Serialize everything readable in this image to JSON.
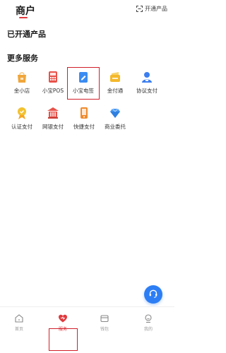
{
  "header": {
    "title": "商户",
    "open_product_label": "开通产品",
    "accent": "#e03a3e"
  },
  "sections": {
    "opened_title": "已开通产品",
    "more_title": "更多服务"
  },
  "services": [
    {
      "label": "金小店",
      "icon": "shop-icon",
      "color": "#f0a63a"
    },
    {
      "label": "小宝POS",
      "icon": "pos-terminal-icon",
      "color": "#e8524a"
    },
    {
      "label": "小宝电签",
      "icon": "e-sign-icon",
      "color": "#3b8cf2",
      "highlighted": true
    },
    {
      "label": "金付通",
      "icon": "wallet-card-icon",
      "color": "#f4b82a"
    },
    {
      "label": "协议支付",
      "icon": "user-agreement-icon",
      "color": "#3b7ef0"
    },
    {
      "label": "认证支付",
      "icon": "verified-badge-icon",
      "color": "#f2c230"
    },
    {
      "label": "网银支付",
      "icon": "bank-icon",
      "color": "#e8524a"
    },
    {
      "label": "快捷支付",
      "icon": "quick-pay-phone-icon",
      "color": "#f08a2c"
    },
    {
      "label": "商业委托",
      "icon": "diamond-icon",
      "color": "#4a9af3"
    }
  ],
  "fab": {
    "icon": "headset-support-icon",
    "color": "#2d7ef5"
  },
  "tabbar": {
    "items": [
      {
        "label": "首页",
        "icon": "home-icon"
      },
      {
        "label": "服务",
        "icon": "service-heart-icon",
        "active": true
      },
      {
        "label": "钱包",
        "icon": "wallet-icon"
      },
      {
        "label": "我的",
        "icon": "profile-icon"
      }
    ]
  }
}
